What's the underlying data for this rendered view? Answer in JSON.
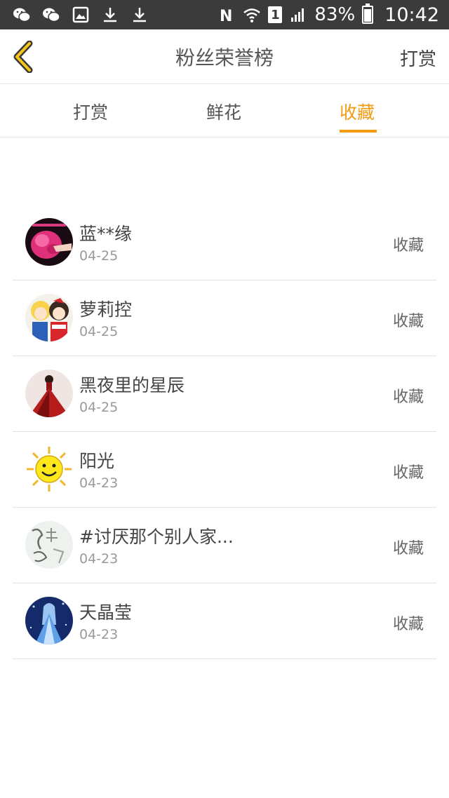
{
  "status_bar": {
    "battery": "83%",
    "time": "10:42",
    "sim": "1",
    "battery_level": 0.83
  },
  "header": {
    "title": "粉丝荣誉榜",
    "action_label": "打赏"
  },
  "tabs": [
    {
      "label": "打赏",
      "active": false
    },
    {
      "label": "鲜花",
      "active": false
    },
    {
      "label": "收藏",
      "active": true
    }
  ],
  "colors": {
    "accent": "#f39c12",
    "status_bar_bg": "#3b3b3b"
  },
  "fans": [
    {
      "name": "蓝**缘",
      "date": "04-25",
      "action": "收藏",
      "avatar": "pink-flower-avatar"
    },
    {
      "name": "萝莉控",
      "date": "04-25",
      "action": "收藏",
      "avatar": "anime-girls-avatar"
    },
    {
      "name": "黑夜里的星辰",
      "date": "04-25",
      "action": "收藏",
      "avatar": "red-dress-avatar"
    },
    {
      "name": "阳光",
      "date": "04-23",
      "action": "收藏",
      "avatar": "smiley-sun-avatar"
    },
    {
      "name": "#讨厌那个别人家...",
      "date": "04-23",
      "action": "收藏",
      "avatar": "calligraphy-avatar"
    },
    {
      "name": "天晶莹",
      "date": "04-23",
      "action": "收藏",
      "avatar": "blue-fairy-avatar"
    }
  ]
}
